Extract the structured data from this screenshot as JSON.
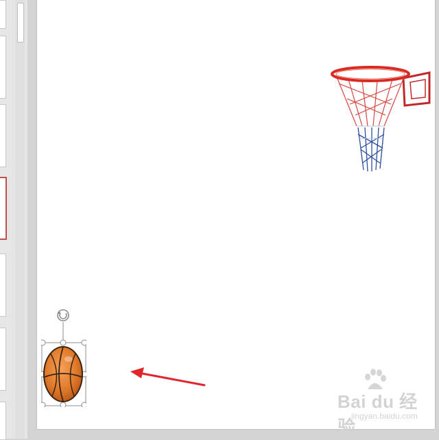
{
  "watermark": {
    "logo_text": "Bai du 经验",
    "url": "jingyan.baidu.com"
  },
  "colors": {
    "accent_selected_thumb": "#c0504d",
    "arrow": "#e0262a",
    "ball": "#e07a2a",
    "hoop_rim": "#d92b24"
  },
  "icons": [
    "rotate-handle-icon",
    "red-arrow",
    "basketball-image",
    "basketball-hoop-image",
    "baidu-paw-icon"
  ]
}
